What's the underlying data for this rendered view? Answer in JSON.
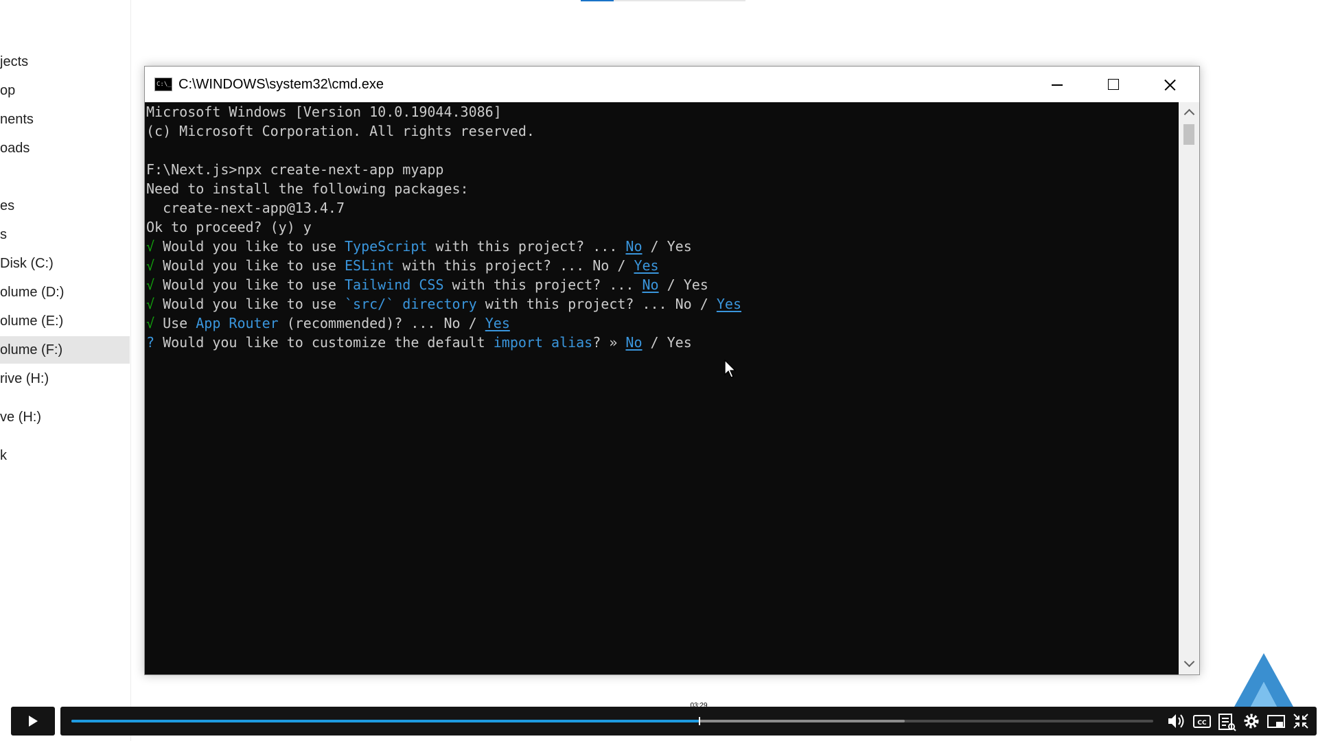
{
  "explorer_sidebar": {
    "items": [
      {
        "label": "jects"
      },
      {
        "label": "op"
      },
      {
        "label": "nents"
      },
      {
        "label": "oads"
      },
      {
        "label": "es"
      },
      {
        "label": "s"
      },
      {
        "label": "Disk (C:)"
      },
      {
        "label": "olume (D:)"
      },
      {
        "label": "olume (E:)"
      },
      {
        "label": "olume (F:)",
        "selected": true
      },
      {
        "label": "rive (H:)"
      },
      {
        "label": "ve (H:)"
      },
      {
        "label": "k"
      }
    ]
  },
  "console_window": {
    "title": "C:\\WINDOWS\\system32\\cmd.exe",
    "icon_label": "C:\\_",
    "buttons": {
      "minimize": "minimize-icon",
      "maximize": "maximize-icon",
      "close": "close-icon"
    },
    "lines": {
      "l1": "Microsoft Windows [Version 10.0.19044.3086]",
      "l2": "(c) Microsoft Corporation. All rights reserved.",
      "l3": "F:\\Next.js>npx create-next-app myapp",
      "l4": "Need to install the following packages:",
      "l5": "  create-next-app@13.4.7",
      "l6": "Ok to proceed? (y) y",
      "q1": {
        "check": "√",
        "pre": " Would you like to use ",
        "hl": "TypeScript",
        "post": " with this project? ... ",
        "no": "No",
        "sep": " / ",
        "yes": "Yes"
      },
      "q2": {
        "check": "√",
        "pre": " Would you like to use ",
        "hl": "ESLint",
        "post": " with this project? ... ",
        "no": "No",
        "sep": " / ",
        "yes": "Yes"
      },
      "q3": {
        "check": "√",
        "pre": " Would you like to use ",
        "hl": "Tailwind CSS",
        "post": " with this project? ... ",
        "no": "No",
        "sep": " / ",
        "yes": "Yes"
      },
      "q4": {
        "check": "√",
        "pre": " Would you like to use ",
        "hl": "`src/` directory",
        "post": " with this project? ... ",
        "no": "No",
        "sep": " / ",
        "yes": "Yes"
      },
      "q5": {
        "check": "√",
        "pre": " Use ",
        "hl": "App Router",
        "post": " (recommended)? ... ",
        "no": "No",
        "sep": " / ",
        "yes": "Yes"
      },
      "q6": {
        "check": "?",
        "pre": " Would you like to customize the default ",
        "hl": "import alias",
        "post": "? » ",
        "no": "No",
        "sep": " / ",
        "yes": "Yes"
      }
    }
  },
  "video_player": {
    "time_tooltip": "03:29",
    "progress_fraction": 0.58,
    "buffered_fraction": 0.77,
    "icons": [
      "play-icon",
      "volume-icon",
      "captions-icon",
      "transcript-icon",
      "settings-icon",
      "picture-in-picture-icon",
      "exit-fullscreen-icon"
    ],
    "accent_color": "#1e9ae0"
  },
  "colors": {
    "console_bg": "#0c0c0c",
    "console_text": "#cccccc",
    "highlight_blue": "#3a96dd",
    "check_green": "#13a10e"
  }
}
